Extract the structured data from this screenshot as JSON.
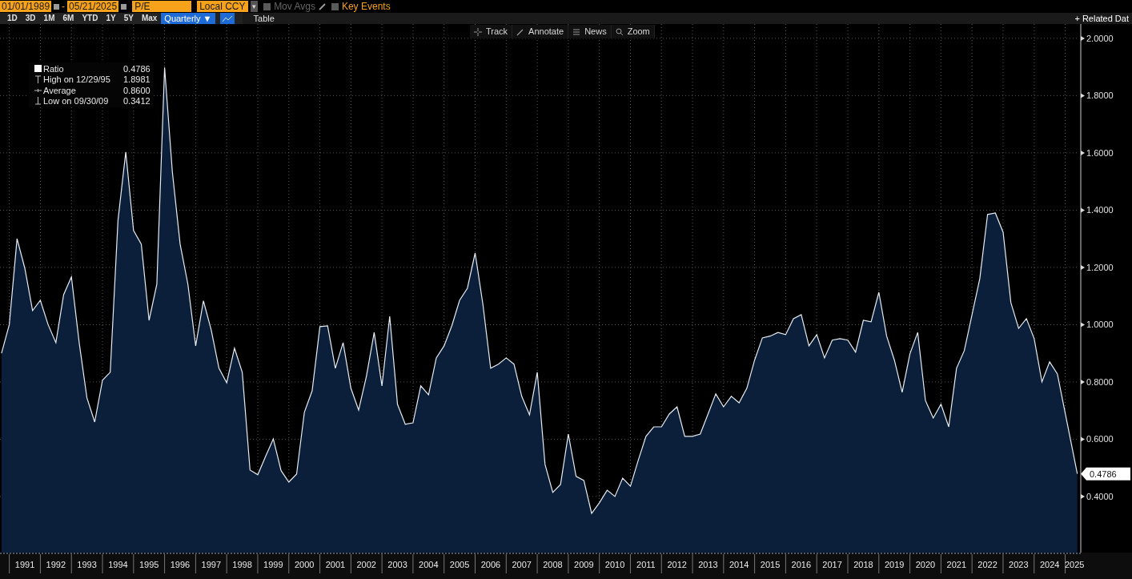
{
  "date_range": {
    "start": "01/01/1989",
    "separator": "-",
    "end": "05/21/2025"
  },
  "field": "P/E",
  "currency": {
    "value": "Local CCY",
    "caret": "▾"
  },
  "toggles": [
    {
      "label": "Mov Avgs",
      "checked": false,
      "disabled": true
    },
    {
      "label": "Key Events",
      "checked": false,
      "disabled": false
    }
  ],
  "periods": [
    {
      "label": "1D",
      "selected": false
    },
    {
      "label": "3D",
      "selected": false
    },
    {
      "label": "1M",
      "selected": false
    },
    {
      "label": "6M",
      "selected": false
    },
    {
      "label": "YTD",
      "selected": false
    },
    {
      "label": "1Y",
      "selected": false
    },
    {
      "label": "5Y",
      "selected": false
    },
    {
      "label": "Max",
      "selected": false
    }
  ],
  "frequency": {
    "label": "Quarterly ▼",
    "selected": true
  },
  "views": [
    {
      "kind": "chart",
      "selected": true
    },
    {
      "kind": "table",
      "label": "Table",
      "selected": false
    }
  ],
  "related": "+ Related Dat",
  "chart_toolbar": [
    "Track",
    "Annotate",
    "News",
    "Zoom"
  ],
  "legend": [
    {
      "kind": "ratio",
      "value": "0.4786"
    },
    {
      "kind": "high",
      "label": "High on 12/29/95",
      "value": "1.8981"
    },
    {
      "kind": "average",
      "label": "Average",
      "value": "0.8600"
    },
    {
      "kind": "low",
      "label": "Low on 09/30/09",
      "value": "0.3412"
    }
  ],
  "last_value": "0.4786",
  "chart_data": {
    "type": "area",
    "grid": true,
    "xlim": [
      1990.7,
      2025.45
    ],
    "ylim": [
      0.204,
      2.05
    ],
    "yticks": [
      {
        "value": 0.4,
        "label": "0.4000"
      },
      {
        "value": 0.6,
        "label": "0.6000"
      },
      {
        "value": 0.8,
        "label": "0.8000"
      },
      {
        "value": 1.0,
        "label": "1.0000"
      },
      {
        "value": 1.2,
        "label": "1.2000"
      },
      {
        "value": 1.4,
        "label": "1.4000"
      },
      {
        "value": 1.6,
        "label": "1.6000"
      },
      {
        "value": 1.8,
        "label": "1.8000"
      },
      {
        "value": 2.0,
        "label": "2.0000"
      }
    ],
    "xticks": [
      {
        "value": 1991.5,
        "label": "1991"
      },
      {
        "value": 1992.5,
        "label": "1992"
      },
      {
        "value": 1993.5,
        "label": "1993"
      },
      {
        "value": 1994.5,
        "label": "1994"
      },
      {
        "value": 1995.5,
        "label": "1995"
      },
      {
        "value": 1996.5,
        "label": "1996"
      },
      {
        "value": 1997.5,
        "label": "1997"
      },
      {
        "value": 1998.5,
        "label": "1998"
      },
      {
        "value": 1999.5,
        "label": "1999"
      },
      {
        "value": 2000.5,
        "label": "2000"
      },
      {
        "value": 2001.5,
        "label": "2001"
      },
      {
        "value": 2002.5,
        "label": "2002"
      },
      {
        "value": 2003.5,
        "label": "2003"
      },
      {
        "value": 2004.5,
        "label": "2004"
      },
      {
        "value": 2005.5,
        "label": "2005"
      },
      {
        "value": 2006.5,
        "label": "2006"
      },
      {
        "value": 2007.5,
        "label": "2007"
      },
      {
        "value": 2008.5,
        "label": "2008"
      },
      {
        "value": 2009.5,
        "label": "2009"
      },
      {
        "value": 2010.5,
        "label": "2010"
      },
      {
        "value": 2011.5,
        "label": "2011"
      },
      {
        "value": 2012.5,
        "label": "2012"
      },
      {
        "value": 2013.5,
        "label": "2013"
      },
      {
        "value": 2014.5,
        "label": "2014"
      },
      {
        "value": 2015.5,
        "label": "2015"
      },
      {
        "value": 2016.5,
        "label": "2016"
      },
      {
        "value": 2017.5,
        "label": "2017"
      },
      {
        "value": 2018.5,
        "label": "2018"
      },
      {
        "value": 2019.5,
        "label": "2019"
      },
      {
        "value": 2020.5,
        "label": "2020"
      },
      {
        "value": 2021.5,
        "label": "2021"
      },
      {
        "value": 2022.5,
        "label": "2022"
      },
      {
        "value": 2023.5,
        "label": "2023"
      },
      {
        "value": 2024.5,
        "label": "2024"
      },
      {
        "value": 2025.3,
        "label": "2025"
      }
    ],
    "x": [
      1990.75,
      1991,
      1991.25,
      1991.5,
      1991.75,
      1992,
      1992.25,
      1992.5,
      1992.75,
      1993,
      1993.25,
      1993.5,
      1993.75,
      1994,
      1994.25,
      1994.5,
      1994.75,
      1995,
      1995.25,
      1995.5,
      1995.75,
      1996,
      1996.25,
      1996.5,
      1996.75,
      1997,
      1997.25,
      1997.5,
      1997.75,
      1998,
      1998.25,
      1998.5,
      1998.75,
      1999,
      1999.25,
      1999.5,
      1999.75,
      2000,
      2000.25,
      2000.5,
      2000.75,
      2001,
      2001.25,
      2001.5,
      2001.75,
      2002,
      2002.25,
      2002.5,
      2002.75,
      2003,
      2003.25,
      2003.5,
      2003.75,
      2004,
      2004.25,
      2004.5,
      2004.75,
      2005,
      2005.25,
      2005.5,
      2005.75,
      2006,
      2006.25,
      2006.5,
      2006.75,
      2007,
      2007.25,
      2007.5,
      2007.75,
      2008,
      2008.25,
      2008.5,
      2008.75,
      2009,
      2009.25,
      2009.5,
      2009.75,
      2010,
      2010.25,
      2010.5,
      2010.75,
      2011,
      2011.25,
      2011.5,
      2011.75,
      2012,
      2012.25,
      2012.5,
      2012.75,
      2013,
      2013.25,
      2013.5,
      2013.75,
      2014,
      2014.25,
      2014.5,
      2014.75,
      2015,
      2015.25,
      2015.5,
      2015.75,
      2016,
      2016.25,
      2016.5,
      2016.75,
      2017,
      2017.25,
      2017.5,
      2017.75,
      2018,
      2018.25,
      2018.5,
      2018.75,
      2019,
      2019.25,
      2019.5,
      2019.75,
      2020,
      2020.25,
      2020.5,
      2020.75,
      2021,
      2021.25,
      2021.5,
      2021.75,
      2022,
      2022.25,
      2022.5,
      2022.75,
      2023,
      2023.25,
      2023.5,
      2023.75,
      2024,
      2024.25,
      2024.5,
      2024.75,
      2025.39
    ],
    "series": [
      {
        "name": "Ratio",
        "color": "#e6ecf2",
        "values": [
          0.9,
          1.0,
          1.3,
          1.197,
          1.049,
          1.085,
          1.0,
          0.937,
          1.105,
          1.167,
          0.937,
          0.744,
          0.66,
          0.806,
          0.834,
          1.365,
          1.603,
          1.329,
          1.281,
          1.015,
          1.141,
          1.898,
          1.533,
          1.281,
          1.141,
          0.926,
          1.083,
          0.982,
          0.848,
          0.797,
          0.918,
          0.834,
          0.492,
          0.476,
          0.54,
          0.601,
          0.49,
          0.45,
          0.478,
          0.694,
          0.769,
          0.993,
          0.996,
          0.848,
          0.937,
          0.778,
          0.702,
          0.82,
          0.973,
          0.786,
          1.029,
          0.722,
          0.652,
          0.657,
          0.786,
          0.755,
          0.884,
          0.926,
          0.996,
          1.085,
          1.127,
          1.25,
          1.071,
          0.848,
          0.862,
          0.884,
          0.862,
          0.75,
          0.685,
          0.834,
          0.512,
          0.414,
          0.442,
          0.618,
          0.47,
          0.456,
          0.341,
          0.378,
          0.422,
          0.4,
          0.464,
          0.436,
          0.526,
          0.61,
          0.643,
          0.643,
          0.688,
          0.713,
          0.61,
          0.61,
          0.618,
          0.688,
          0.758,
          0.713,
          0.75,
          0.727,
          0.778,
          0.876,
          0.954,
          0.96,
          0.973,
          0.965,
          1.021,
          1.035,
          0.926,
          0.965,
          0.884,
          0.946,
          0.951,
          0.946,
          0.904,
          1.015,
          1.01,
          1.113,
          0.96,
          0.876,
          0.764,
          0.898,
          0.973,
          0.735,
          0.674,
          0.722,
          0.643,
          0.848,
          0.909,
          1.035,
          1.161,
          1.385,
          1.39,
          1.323,
          1.077,
          0.987,
          1.021,
          0.951,
          0.8,
          0.87,
          0.828,
          0.479
        ]
      }
    ]
  }
}
